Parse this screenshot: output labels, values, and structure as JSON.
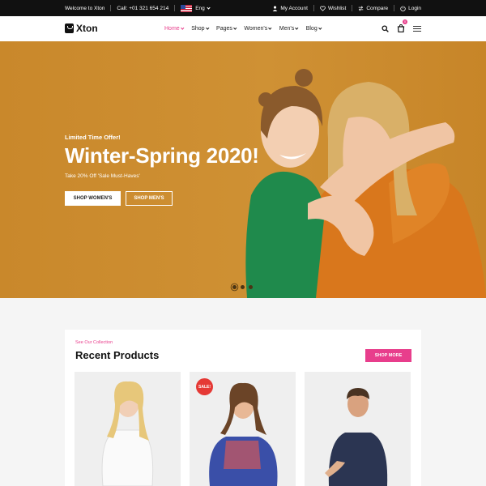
{
  "topbar": {
    "welcome": "Welcome to Xton",
    "phone": "Call: +01 321 654 214",
    "language": "Eng",
    "links": [
      {
        "label": "My Account",
        "icon": "user-icon"
      },
      {
        "label": "Wishlist",
        "icon": "heart-icon"
      },
      {
        "label": "Compare",
        "icon": "compare-icon"
      },
      {
        "label": "Login",
        "icon": "login-icon"
      }
    ]
  },
  "header": {
    "logo": "Xton",
    "nav": [
      {
        "label": "Home",
        "active": true
      },
      {
        "label": "Shop"
      },
      {
        "label": "Pages"
      },
      {
        "label": "Women's"
      },
      {
        "label": "Men's"
      },
      {
        "label": "Blog"
      }
    ],
    "cart_count": "0"
  },
  "hero": {
    "kicker": "Limited Time Offer!",
    "title": "Winter-Spring 2020!",
    "subtitle": "Take 20% Off 'Sale Must-Haves'",
    "button_primary": "SHOP WOMEN'S",
    "button_secondary": "SHOP MEN'S",
    "slides": 3,
    "active_slide": 1
  },
  "products": {
    "kicker": "See Our Collection",
    "title": "Recent Products",
    "shop_more": "SHOP MORE",
    "items": [
      {
        "badge": ""
      },
      {
        "badge": "SALE!"
      },
      {
        "badge": ""
      }
    ]
  },
  "colors": {
    "accent": "#e83e8c",
    "hero_bg": "#cc8d31",
    "topbar_bg": "#111111",
    "sale_badge": "#e53935"
  }
}
